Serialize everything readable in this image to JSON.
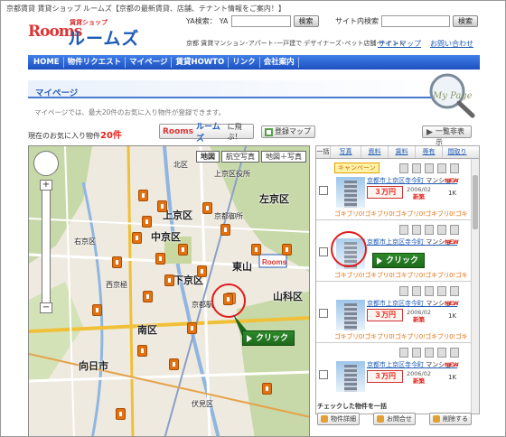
{
  "header": {
    "tagline": "京都賃貸 賃貸ショップ ルームズ【京都の最新賃貸、店舗、テナント情報をご案内！】",
    "logo_top": "賃貸ショップ",
    "logo_main": "ルームズ",
    "logo_mark": "Rooms",
    "ya_search_label": "YA検索：",
    "ya_label": "YA",
    "ya_button": "検索",
    "site_search_label": "サイト内検索",
    "site_button": "検索",
    "links_text": "京都 賃貸マンション･アパート･一戸建で デザイナーズ･ペット店舗･テナント",
    "sitemap": "サイトマップ",
    "contact": "お問い合わせ"
  },
  "nav": [
    "HOME",
    "物件リクエスト",
    "マイページ",
    "賃貸HOWTO",
    "リンク",
    "会社案内"
  ],
  "page": {
    "title": "マイページ",
    "badge": "My Page",
    "description": "マイページでは、最大20件のお気に入り物件が登録できます。",
    "count_label": "現在のお気に入り物件",
    "count_value": "20件",
    "jump_button": "に飛ぶ！",
    "jump_logo": "Rooms",
    "jump_logo2": "ルームズ",
    "map_button": "登録マップ",
    "list_button": "一覧非表示"
  },
  "map": {
    "tabs": [
      "地図",
      "航空写真",
      "地図＋写真"
    ],
    "zoom_plus": "+",
    "zoom_minus": "−",
    "places": [
      "上京区",
      "中京区",
      "東山",
      "左京区",
      "山科区",
      "南区",
      "向日市",
      "下京区",
      "西京極",
      "上京区役所",
      "京都御所",
      "北区",
      "右京区",
      "伏見区",
      "京都駅"
    ]
  },
  "list": {
    "headers": [
      "一括",
      "写真",
      "資料",
      "賃料",
      "専有",
      "間取り"
    ],
    "campaign": "キャンペーン",
    "rows": [
      {
        "title": "京都市上京区寺今町",
        "type": "マンション",
        "price": "３万円",
        "date": "2006/02",
        "date_tag": "新築",
        "layout": "1K",
        "new": "NEW",
        "ticker": "ゴキブリ0!ゴキブリ0!ゴキブリ0!ゴキブリ0!ゴキ"
      },
      {
        "title": "京都市上京区寺今町",
        "type": "マンション",
        "price": "３万円",
        "date": "2006/02",
        "date_tag": "新築",
        "layout": "1K",
        "new": "NEW",
        "ticker": "ゴキブリ0!ゴキブリ0!ゴキブリ0!ゴキブリ0!ゴキ"
      },
      {
        "title": "京都市上京区寺今町",
        "type": "マンション",
        "price": "３万円",
        "date": "2006/02",
        "date_tag": "新築",
        "layout": "1K",
        "new": "NEW",
        "ticker": "ゴキブリ0!ゴキブリ0!ゴキブリ0!ゴキブリ0!ゴキ"
      },
      {
        "title": "京都市上京区寺今町",
        "type": "マンション",
        "price": "３万円",
        "date": "2006/02",
        "date_tag": "新築",
        "layout": "1K",
        "new": "NEW",
        "ticker": ""
      }
    ]
  },
  "actions": {
    "checked_label": "チェックした物件を一括",
    "detail": "物件詳細",
    "inquire": "お問合せ",
    "delete": "削除する"
  },
  "callouts": {
    "click_label": "クリック"
  },
  "colors": {
    "brand_blue": "#1f5bb5",
    "accent_red": "#e4241c",
    "callout_green": "#1e6a1b",
    "pin_orange": "#e07214"
  }
}
